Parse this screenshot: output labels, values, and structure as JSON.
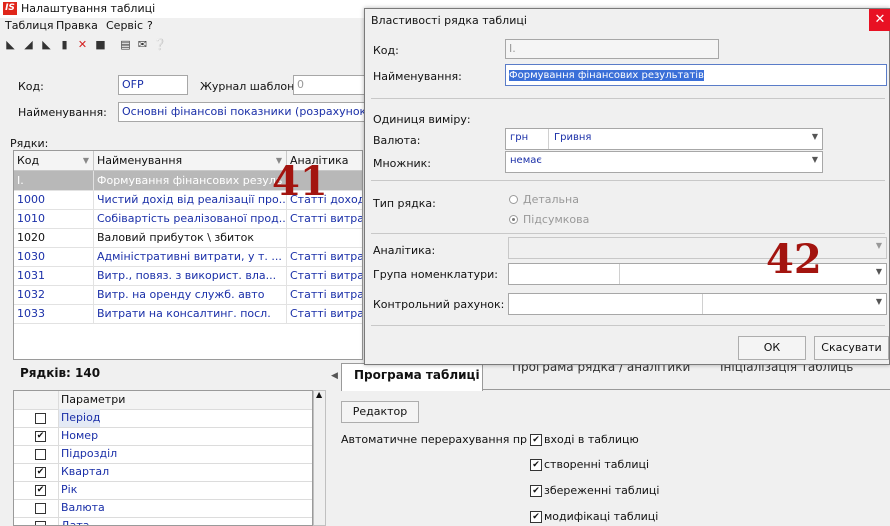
{
  "main": {
    "title": "Налаштування таблиці",
    "logo": "IS",
    "menu": [
      "Таблиця",
      "Правка",
      "Сервіс",
      "?"
    ],
    "toolbar_icons": [
      "new-icon",
      "open-icon",
      "copy-icon",
      "doc-icon",
      "delete-icon",
      "square-icon",
      "page-icon",
      "mail-icon",
      "help-icon"
    ],
    "code_label": "Код:",
    "code_value": "OFP",
    "journal_label": "Журнал шаблону",
    "journal_value": "0",
    "name_label": "Найменування:",
    "name_value": "Основні фінансові показники (розрахунок",
    "rows_label": "Рядки:",
    "grid_headers": [
      "Код",
      "Найменування",
      "Аналітика"
    ],
    "grid_rows": [
      {
        "code": "I.",
        "name": "Формування фінансових резуль",
        "analytics": ""
      },
      {
        "code": "1000",
        "name": "Чистий дохід від реалізації про...",
        "analytics": "Статті доход"
      },
      {
        "code": "1010",
        "name": "Собівартість реалізованої прод...",
        "analytics": "Статті витра"
      },
      {
        "code": "1020",
        "name": "Валовий прибуток \\ збиток",
        "analytics": ""
      },
      {
        "code": "1030",
        "name": "Адміністративні витрати, у т. ...",
        "analytics": "Статті витра"
      },
      {
        "code": "1031",
        "name": "Витр., повяз. з використ. вла...",
        "analytics": "Статті витра"
      },
      {
        "code": "1032",
        "name": "Витр. на оренду служб. авто",
        "analytics": "Статті витра"
      },
      {
        "code": "1033",
        "name": "Витрати на консалтинг. посл.",
        "analytics": "Статті витра"
      }
    ],
    "rows_count": "Рядків: 140",
    "params_header": "Параметри",
    "params": [
      {
        "label": "Період",
        "checked": false,
        "selected": true
      },
      {
        "label": "Номер",
        "checked": true
      },
      {
        "label": "Підрозділ",
        "checked": false
      },
      {
        "label": "Квартал",
        "checked": true
      },
      {
        "label": "Рік",
        "checked": true
      },
      {
        "label": "Валюта",
        "checked": false
      },
      {
        "label": "Дата",
        "checked": false
      }
    ],
    "tabs": [
      "Програма таблиці",
      "Програма рядка / аналітики",
      "Ініціалізація таблиць"
    ],
    "editor_button": "Редактор",
    "auto_recalc_label": "Автоматичне перерахування пр",
    "auto_checks": [
      "вході в таблицю",
      "створенні таблиці",
      "збереженні таблиці",
      "модифікаці таблиці"
    ]
  },
  "dialog": {
    "title": "Властивості рядка таблиці",
    "code_label": "Код:",
    "code_value": "I.",
    "name_label": "Найменування:",
    "name_value": "Формування фінансових результатів",
    "unit_label": "Одиниця виміру:",
    "currency_label": "Валюта:",
    "currency_code": "грн",
    "currency_name": "Гривня",
    "multiplier_label": "Множник:",
    "multiplier_value": "немає",
    "row_type_label": "Тип рядка:",
    "row_type_options": [
      "Детальна",
      "Підсумкова"
    ],
    "row_type_selected": "Підсумкова",
    "analytics_label": "Аналітика:",
    "nomenclature_label": "Група номенклатури:",
    "account_label": "Контрольний рахунок:",
    "ok_button": "ОК",
    "cancel_button": "Скасувати"
  },
  "annotations": [
    "41",
    "42"
  ],
  "colors": {
    "accent_blue": "#1a2fa8",
    "annotation_red": "#a3140f",
    "close_red": "#e81123"
  }
}
